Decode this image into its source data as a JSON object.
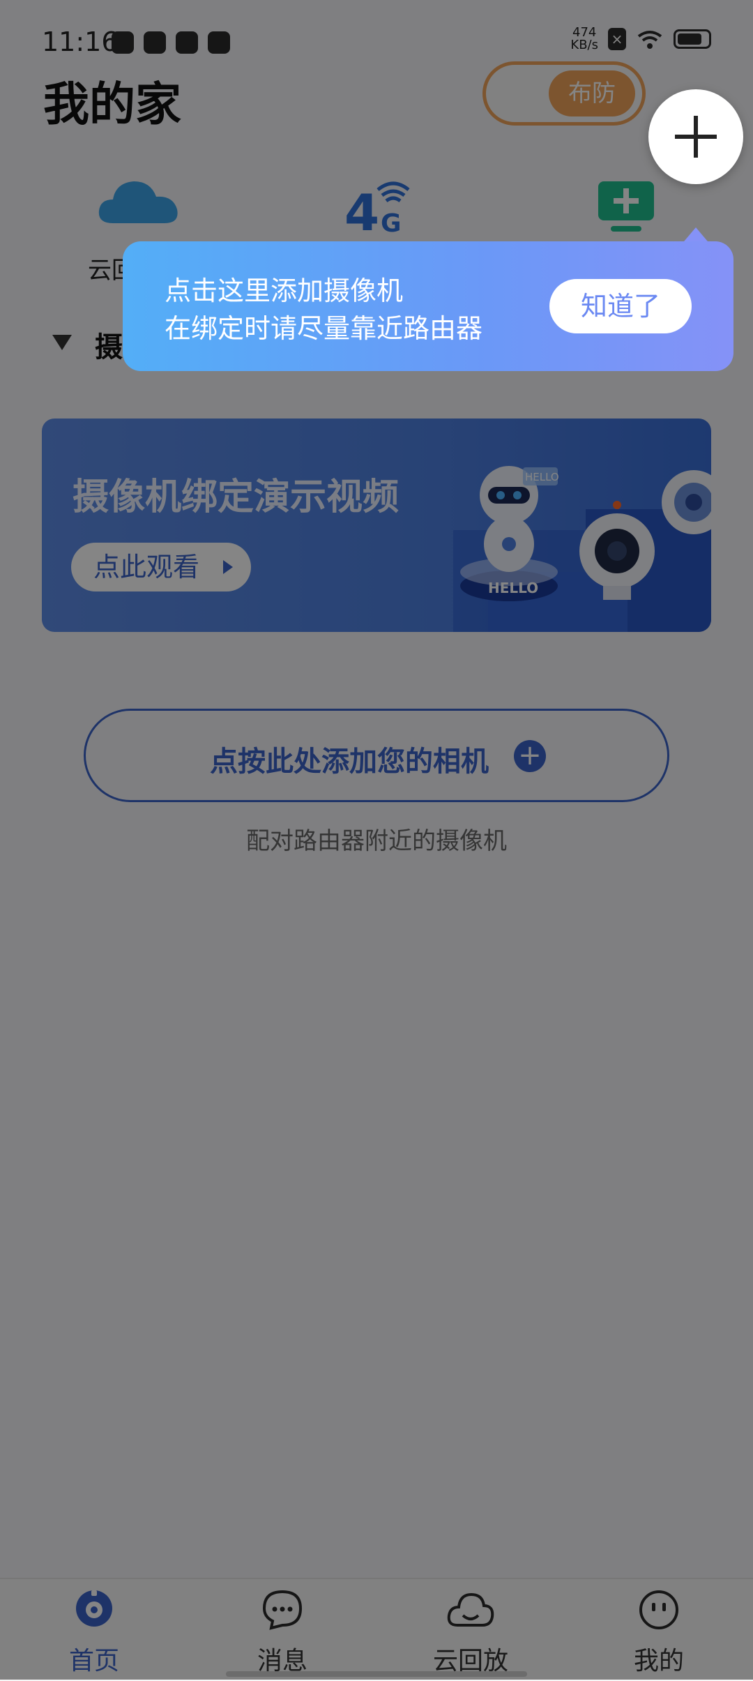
{
  "status": {
    "time": "11:16",
    "net_speed_value": "474",
    "net_speed_unit": "KB/s"
  },
  "header": {
    "title": "我的家",
    "arm_toggle_label": "布防"
  },
  "quick_actions": [
    {
      "label": "云回放",
      "icon": "cloud-icon"
    },
    {
      "label": "4G",
      "icon": "4g-signal-icon"
    },
    {
      "label": "",
      "icon": "add-screen-icon"
    }
  ],
  "section": {
    "title": "摄像机"
  },
  "banner": {
    "title": "摄像机绑定演示视频",
    "watch_label": "点此观看",
    "hello_text": "HELLO"
  },
  "add_camera": {
    "label": "点按此处添加您的相机",
    "hint": "配对路由器附近的摄像机"
  },
  "tooltip": {
    "line1": "点击这里添加摄像机",
    "line2": "在绑定时请尽量靠近路由器",
    "confirm_label": "知道了"
  },
  "nav": {
    "items": [
      {
        "label": "首页",
        "icon": "home-icon",
        "active": true
      },
      {
        "label": "消息",
        "icon": "message-icon",
        "active": false
      },
      {
        "label": "云回放",
        "icon": "cloud-playback-icon",
        "active": false
      },
      {
        "label": "我的",
        "icon": "profile-icon",
        "active": false
      }
    ]
  },
  "colors": {
    "accent": "#3b62c7",
    "arm_orange": "#f0a35a",
    "tooltip_start": "#53aef7",
    "tooltip_end": "#8592f7"
  }
}
